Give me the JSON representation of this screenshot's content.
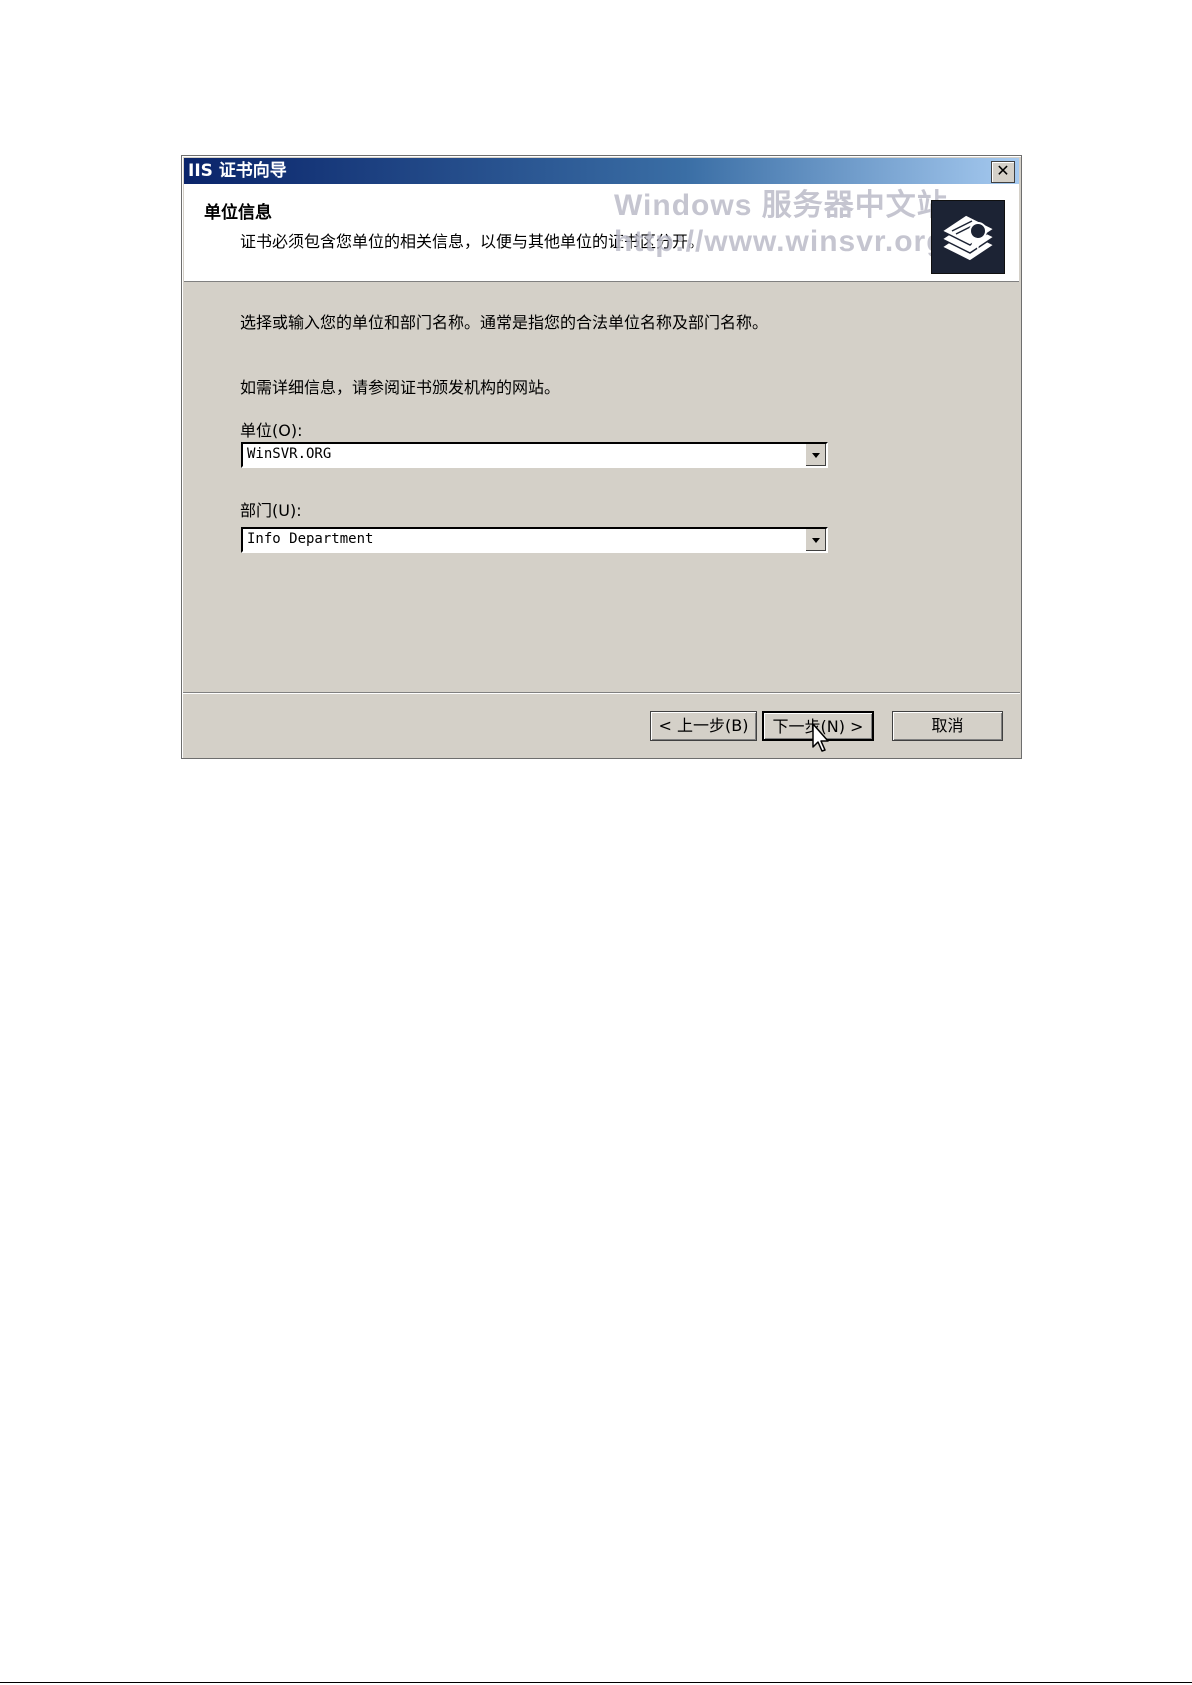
{
  "window": {
    "title": "IIS 证书向导",
    "close_label": "✕"
  },
  "header": {
    "title": "单位信息",
    "description": "证书必须包含您单位的相关信息，以便与其他单位的证书区分开。",
    "watermark_line1": "Windows 服务器中文站",
    "watermark_line2": "http://www.winsvr.org",
    "icon": "certificate-stack-icon"
  },
  "body": {
    "instruction": "选择或输入您的单位和部门名称。通常是指您的合法单位名称及部门名称。",
    "more_info": "如需详细信息，请参阅证书颁发机构的网站。"
  },
  "fields": {
    "organization": {
      "label": "单位(O):",
      "value": "WinSVR.ORG"
    },
    "department": {
      "label": "部门(U):",
      "value": "Info Department"
    }
  },
  "buttons": {
    "back": "< 上一步(B)",
    "next": "下一步(N) >",
    "cancel": "取消"
  },
  "colors": {
    "title_bar_start": "#0a246a",
    "title_bar_end": "#a6caf0",
    "dialog_face": "#d4d0c8"
  }
}
